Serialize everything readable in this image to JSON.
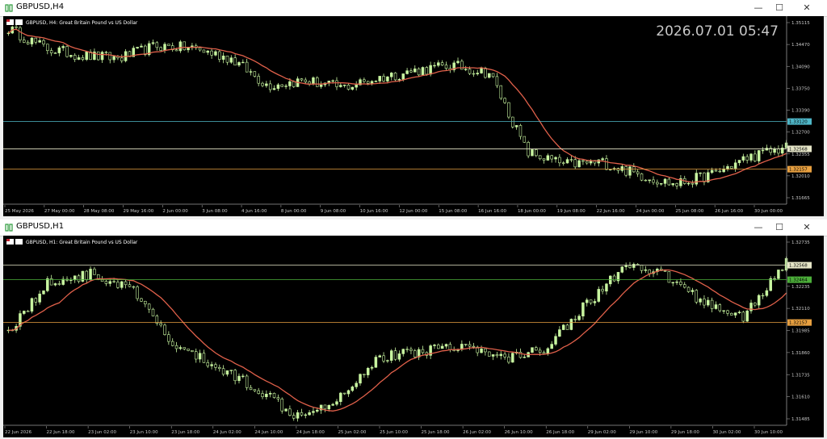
{
  "top_window": {
    "title": "GBPUSD,H4",
    "chart_label": "GBPUSD, H4:  Great Britain Pound vs US Dollar",
    "clock": "2026.07.01 05:47",
    "buttons": {
      "minimize": "—",
      "maximize": "☐",
      "close": "✕"
    },
    "price_ticks": [
      "1.35115",
      "1.34470",
      "1.34090",
      "1.33750",
      "1.33390",
      "1.32700",
      "1.32355",
      "1.32010",
      "1.31665"
    ],
    "price_tags": [
      {
        "label": "1.33120",
        "price": 1.3312,
        "color": "#4fb7c8"
      },
      {
        "label": "1.32568",
        "price": 1.32568,
        "color": "#e6e6c8"
      },
      {
        "label": "1.32157",
        "price": 1.32157,
        "color": "#e8a040"
      }
    ],
    "time_labels": [
      "25 May 2026",
      "27 May 00:00",
      "28 May 08:00",
      "29 May 16:00",
      "2 Jun 00:00",
      "3 Jun 08:00",
      "4 Jun 16:00",
      "8 Jun 00:00",
      "9 Jun 08:00",
      "10 Jun 16:00",
      "12 Jun 00:00",
      "15 Jun 08:00",
      "16 Jun 16:00",
      "18 Jun 00:00",
      "19 Jun 08:00",
      "22 Jun 16:00",
      "24 Jun 00:00",
      "25 Jun 08:00",
      "26 Jun 16:00",
      "30 Jun 00:00"
    ],
    "price_range": [
      1.3145,
      1.3525
    ]
  },
  "bottom_window": {
    "title": "GBPUSD,H1",
    "chart_label": "GBPUSD, H1:  Great Britain Pound vs US Dollar",
    "buttons": {
      "minimize": "—",
      "maximize": "☐",
      "close": "✕"
    },
    "price_ticks": [
      "1.32735",
      "1.32360",
      "1.32235",
      "1.32110",
      "1.31985",
      "1.31860",
      "1.31735",
      "1.31610",
      "1.31485"
    ],
    "price_tags": [
      {
        "label": "1.32568",
        "price": 1.32568,
        "color": "#e6e6c8"
      },
      {
        "label": "1.32464",
        "price": 1.32464,
        "color": "#4caf3a"
      },
      {
        "label": "1.32157",
        "price": 1.32157,
        "color": "#e8a040"
      }
    ],
    "time_labels": [
      "22 Jun 2026",
      "22 Jun 18:00",
      "23 Jun 02:00",
      "23 Jun 10:00",
      "23 Jun 18:00",
      "24 Jun 02:00",
      "24 Jun 10:00",
      "24 Jun 18:00",
      "25 Jun 02:00",
      "25 Jun 10:00",
      "25 Jun 18:00",
      "26 Jun 02:00",
      "26 Jun 10:00",
      "26 Jun 18:00",
      "29 Jun 02:00",
      "29 Jun 10:00",
      "29 Jun 18:00",
      "30 Jun 02:00",
      "30 Jun 10:00"
    ],
    "price_range": [
      1.3142,
      1.3278
    ]
  },
  "colors": {
    "bull": "#c8f5a0",
    "bear": "#c8f5a0",
    "ma": "#e0604a",
    "background": "#000000"
  }
}
